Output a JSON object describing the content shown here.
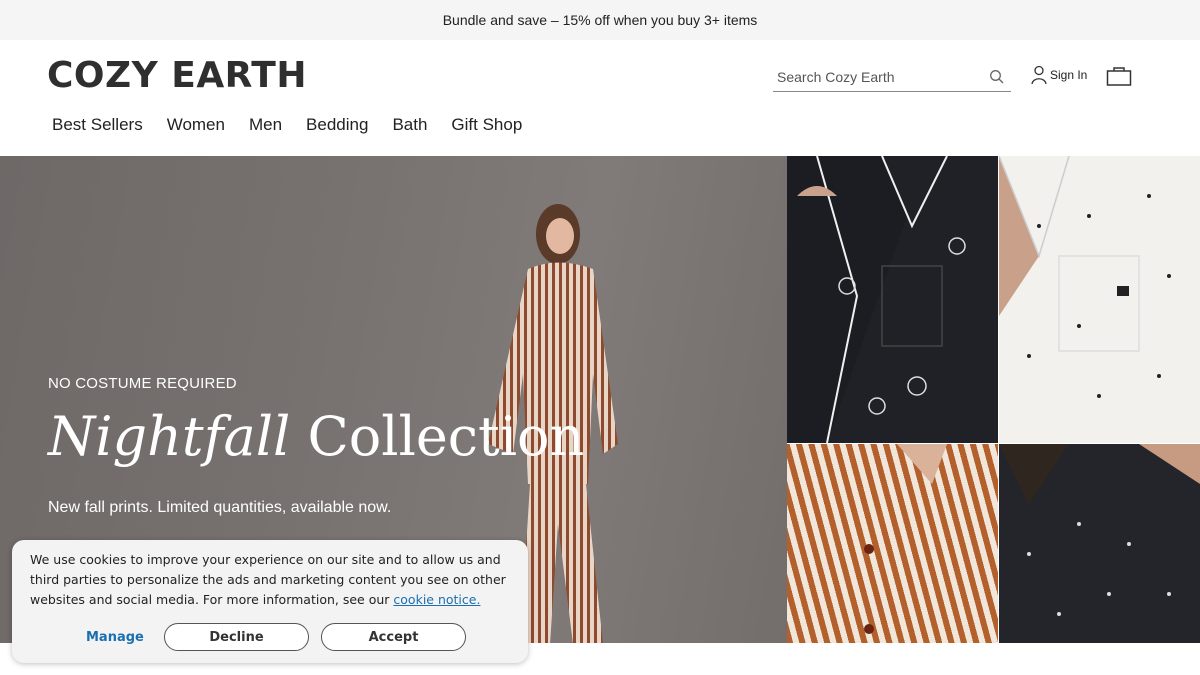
{
  "announcement": {
    "text": "Bundle and save – 15% off when you buy 3+ items"
  },
  "header": {
    "logo": "COZY EARTH",
    "search": {
      "placeholder": "Search Cozy Earth",
      "value": ""
    },
    "sign_in": "Sign In",
    "icons": {
      "search": "search-icon",
      "account": "user-icon",
      "bag": "shopping-bag-icon"
    }
  },
  "nav": {
    "items": [
      {
        "label": "Best Sellers"
      },
      {
        "label": "Women"
      },
      {
        "label": "Men"
      },
      {
        "label": "Bedding"
      },
      {
        "label": "Bath"
      },
      {
        "label": "Gift Shop"
      }
    ]
  },
  "hero": {
    "eyebrow": "NO COSTUME REQUIRED",
    "title_italic": "Nightfall",
    "title_rest": "Collection",
    "subtitle": "New fall prints. Limited quantities, available now."
  },
  "cookie_banner": {
    "text": "We use cookies to improve your experience on our site and to allow us and third parties to personalize the ads and marketing content you see on other websites and social media. For more information, see our ",
    "link": "cookie notice.",
    "manage": "Manage",
    "decline": "Decline",
    "accept": "Accept"
  },
  "colors": {
    "link": "#1a6fb0",
    "hero_bg": "#77716f",
    "announcement_bg": "#f5f5f5"
  }
}
